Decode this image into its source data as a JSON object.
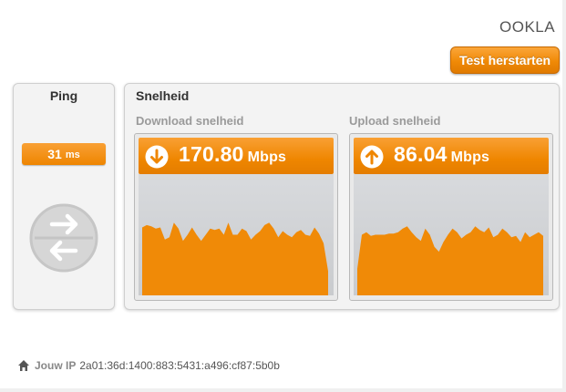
{
  "brand": {
    "logo_text": "OOKLA"
  },
  "actions": {
    "restart_label": "Test herstarten"
  },
  "ping": {
    "title": "Ping",
    "value": "31",
    "unit": "ms",
    "icon": "ping-arrows-icon"
  },
  "speed": {
    "title": "Snelheid",
    "download": {
      "label": "Download snelheid",
      "value": "170.80",
      "unit": "Mbps",
      "icon": "download-arrow-icon",
      "graph_samples": [
        0.56,
        0.58,
        0.57,
        0.55,
        0.56,
        0.46,
        0.48,
        0.6,
        0.55,
        0.45,
        0.5,
        0.56,
        0.5,
        0.45,
        0.5,
        0.55,
        0.54,
        0.55,
        0.5,
        0.6,
        0.5,
        0.5,
        0.55,
        0.53,
        0.46,
        0.5,
        0.53,
        0.58,
        0.6,
        0.55,
        0.48,
        0.53,
        0.5,
        0.48,
        0.52,
        0.54,
        0.5,
        0.49,
        0.56,
        0.51,
        0.43,
        0.2
      ]
    },
    "upload": {
      "label": "Upload snelheid",
      "value": "86.04",
      "unit": "Mbps",
      "icon": "upload-arrow-icon",
      "graph_samples": [
        0.22,
        0.5,
        0.52,
        0.49,
        0.5,
        0.5,
        0.5,
        0.51,
        0.51,
        0.52,
        0.55,
        0.57,
        0.52,
        0.48,
        0.45,
        0.55,
        0.5,
        0.4,
        0.36,
        0.44,
        0.5,
        0.55,
        0.52,
        0.47,
        0.5,
        0.52,
        0.57,
        0.54,
        0.52,
        0.56,
        0.48,
        0.5,
        0.55,
        0.52,
        0.48,
        0.49,
        0.44,
        0.52,
        0.48,
        0.5,
        0.52,
        0.49
      ]
    }
  },
  "footer": {
    "ip_label": "Jouw IP",
    "ip_value": "2a01:36d:1400:883:5431:a496:cf87:5b0b",
    "icon": "home-icon"
  },
  "colors": {
    "accent": "#f08a07",
    "graph_bg": "#cfd1d4",
    "panel_bg": "#f3f3f3"
  }
}
